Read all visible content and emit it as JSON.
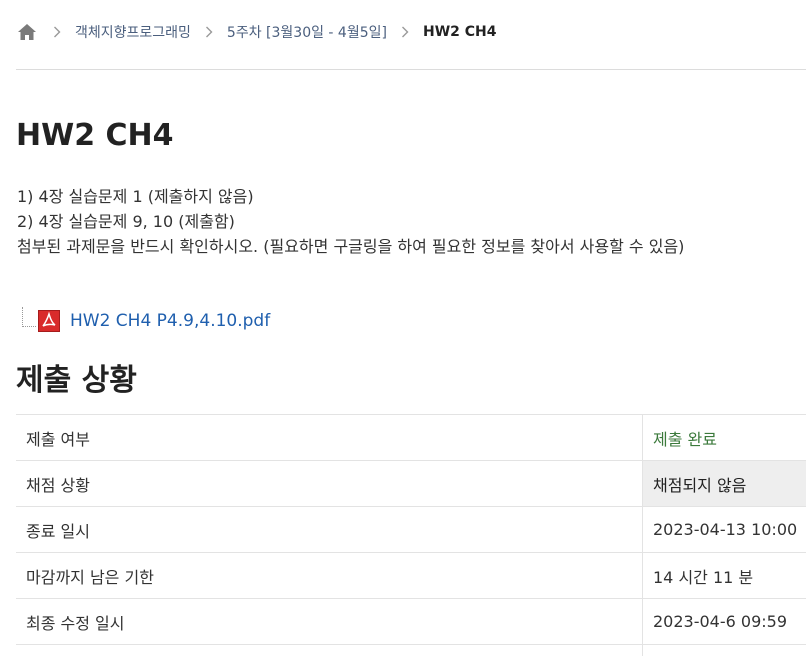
{
  "breadcrumb": {
    "home_icon": "home-icon",
    "items": [
      "객체지향프로그래밍",
      "5주차 [3월30일 - 4월5일]"
    ],
    "current": "HW2 CH4"
  },
  "assignment": {
    "title": "HW2 CH4",
    "description": [
      "1) 4장 실습문제 1 (제출하지 않음)",
      "2) 4장 실습문제 9, 10 (제출함)",
      "첨부된 과제문을 반드시 확인하시오. (필요하면 구글링을 하여 필요한 정보를 찾아서 사용할 수 있음)"
    ],
    "attachment": {
      "icon": "pdf-icon",
      "filename": "HW2 CH4 P4.9,4.10.pdf"
    }
  },
  "submission": {
    "section_title": "제출 상황",
    "rows": [
      {
        "label": "제출 여부",
        "value": "제출 완료"
      },
      {
        "label": "채점 상황",
        "value": "채점되지 않음"
      },
      {
        "label": "종료 일시",
        "value": "2023-04-13 10:00"
      },
      {
        "label": "마감까지 남은 기한",
        "value": "14 시간 11 분"
      },
      {
        "label": "최종 수정 일시",
        "value": "2023-04-6 09:59"
      },
      {
        "label": "",
        "value": ""
      }
    ]
  },
  "colors": {
    "link": "#1f5fae",
    "submitted": "#3c7a3c",
    "graded_bg": "#eeeeee"
  }
}
